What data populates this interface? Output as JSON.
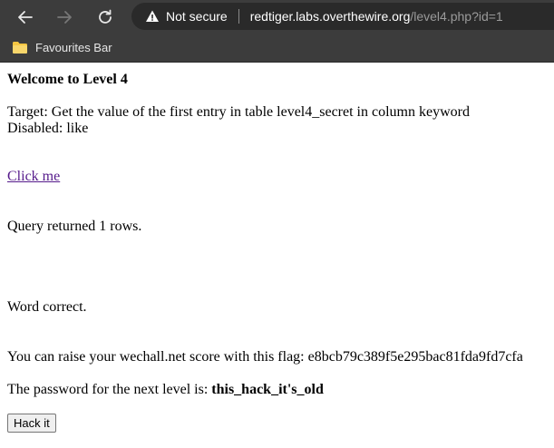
{
  "browser": {
    "security_label": "Not secure",
    "url_host": "redtiger.labs.overthewire.org",
    "url_path": "/level4.php?id=1",
    "favourites_label": "Favourites Bar"
  },
  "page": {
    "title": "Welcome to Level 4",
    "target_text": "Target: Get the value of the first entry in table level4_secret in column keyword",
    "disabled_text": "Disabled: like",
    "link_text": "Click me",
    "query_text": "Query returned 1 rows.",
    "word_text": "Word correct.",
    "flag_text": "You can raise your wechall.net score with this flag: e8bcb79c389f5e295bac81fda9fd7cfa",
    "password_prefix": "The password for the next level is: ",
    "password_value": "this_hack_it's_old",
    "hack_button_label": "Hack it"
  }
}
